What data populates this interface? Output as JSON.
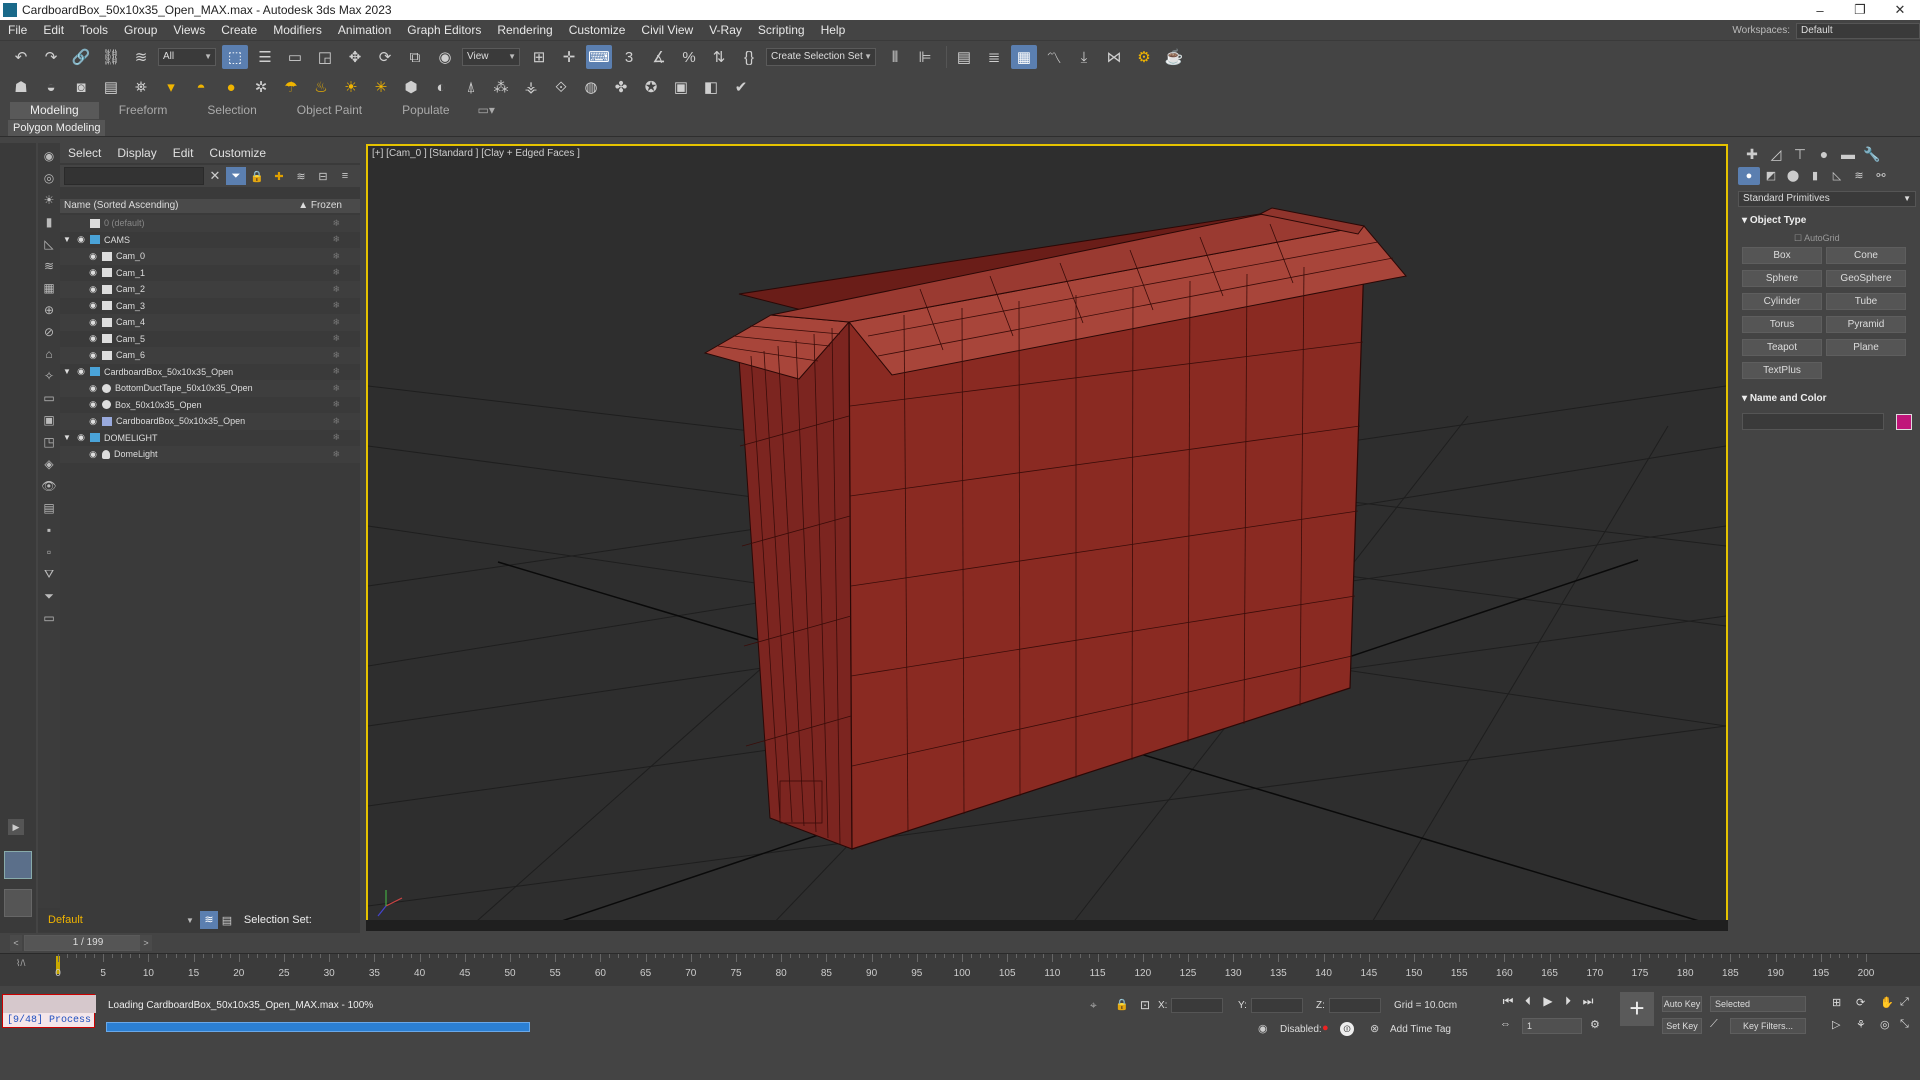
{
  "window": {
    "title": "CardboardBox_50x10x35_Open_MAX.max - Autodesk 3ds Max 2023",
    "controls": [
      "–",
      "❐",
      "✕"
    ]
  },
  "menu": {
    "items": [
      "File",
      "Edit",
      "Tools",
      "Group",
      "Views",
      "Create",
      "Modifiers",
      "Animation",
      "Graph Editors",
      "Rendering",
      "Customize",
      "Civil View",
      "V-Ray",
      "Scripting",
      "Help"
    ],
    "workspaces_label": "Workspaces:",
    "workspaces_value": "Default"
  },
  "toolbar": {
    "filter_value": "All",
    "view_value": "View",
    "selection_set": "Create Selection Set",
    "snap_label": "3",
    "snap_angle": "∡",
    "snap_percent": "%"
  },
  "ribbon": {
    "tabs": [
      "Modeling",
      "Freeform",
      "Selection",
      "Object Paint",
      "Populate"
    ],
    "active": "Modeling",
    "sub_label": "Polygon Modeling"
  },
  "scene_explorer": {
    "menu": [
      "Select",
      "Display",
      "Edit",
      "Customize"
    ],
    "column_name": "Name (Sorted Ascending)",
    "column_frozen": "▲ Frozen",
    "rows": [
      {
        "name": "0 (default)",
        "indent": 1,
        "dim": true,
        "eye": "",
        "icon": "layer"
      },
      {
        "name": "CAMS",
        "indent": 0,
        "dim": false,
        "eye": "👁",
        "icon": "expand"
      },
      {
        "name": "Cam_0",
        "indent": 2,
        "dim": false,
        "eye": "👁",
        "icon": "cam"
      },
      {
        "name": "Cam_1",
        "indent": 2,
        "dim": false,
        "eye": "👁",
        "icon": "cam"
      },
      {
        "name": "Cam_2",
        "indent": 2,
        "dim": false,
        "eye": "👁",
        "icon": "cam"
      },
      {
        "name": "Cam_3",
        "indent": 2,
        "dim": false,
        "eye": "👁",
        "icon": "cam"
      },
      {
        "name": "Cam_4",
        "indent": 2,
        "dim": false,
        "eye": "👁",
        "icon": "cam"
      },
      {
        "name": "Cam_5",
        "indent": 2,
        "dim": false,
        "eye": "👁",
        "icon": "cam"
      },
      {
        "name": "Cam_6",
        "indent": 2,
        "dim": false,
        "eye": "👁",
        "icon": "cam"
      },
      {
        "name": "CardboardBox_50x10x35_Open",
        "indent": 0,
        "dim": false,
        "eye": "👁",
        "icon": "expand"
      },
      {
        "name": "BottomDuctTape_50x10x35_Open",
        "indent": 2,
        "dim": false,
        "eye": "👁",
        "icon": "sphere"
      },
      {
        "name": "Box_50x10x35_Open",
        "indent": 2,
        "dim": false,
        "eye": "👁",
        "icon": "sphere"
      },
      {
        "name": "CardboardBox_50x10x35_Open",
        "indent": 2,
        "dim": false,
        "eye": "👁",
        "icon": "group"
      },
      {
        "name": "DOMELIGHT",
        "indent": 0,
        "dim": false,
        "eye": "👁",
        "icon": "expand"
      },
      {
        "name": "DomeLight",
        "indent": 2,
        "dim": false,
        "eye": "👁",
        "icon": "light"
      }
    ],
    "layer_value": "Default",
    "selection_set_label": "Selection Set:"
  },
  "viewport": {
    "label": "[+] [Cam_0 ] [Standard ] [Clay + Edged Faces ]",
    "colors": {
      "border": "#e6c300",
      "box": "#8a2a22",
      "box_top": "#a8453a",
      "background": "#2e2e2e"
    }
  },
  "command_panel": {
    "category": "Standard Primitives",
    "object_type_title": "Object Type",
    "autogrid_label": "AutoGrid",
    "buttons": [
      "Box",
      "Cone",
      "Sphere",
      "GeoSphere",
      "Cylinder",
      "Tube",
      "Torus",
      "Pyramid",
      "Teapot",
      "Plane",
      "TextPlus"
    ],
    "name_color_title": "Name and Color",
    "swatch_color": "#c0157a"
  },
  "timeline": {
    "frame_display": "1 / 199",
    "ticks": [
      "5",
      "10",
      "15",
      "20",
      "25",
      "30",
      "35",
      "40",
      "45",
      "50",
      "55",
      "60",
      "65",
      "70",
      "75",
      "80",
      "85",
      "90",
      "95",
      "100",
      "105",
      "110",
      "115",
      "120",
      "125",
      "130",
      "135",
      "140",
      "145",
      "150",
      "155",
      "160",
      "165",
      "170",
      "175",
      "180",
      "185",
      "190",
      "195",
      "200"
    ],
    "start_tick": "0"
  },
  "status": {
    "process_text": "[9/48] Process",
    "loading_text": "Loading CardboardBox_50x10x35_Open_MAX.max  -  100%",
    "progress_percent": 100,
    "x_label": "X:",
    "y_label": "Y:",
    "z_label": "Z:",
    "grid_text": "Grid = 10.0cm",
    "disabled_label": "Disabled:",
    "add_time_tag": "Add Time Tag",
    "auto_key": "Auto Key",
    "set_key": "Set Key",
    "selected_value": "Selected",
    "key_filters": "Key Filters...",
    "frame_input": "1"
  }
}
